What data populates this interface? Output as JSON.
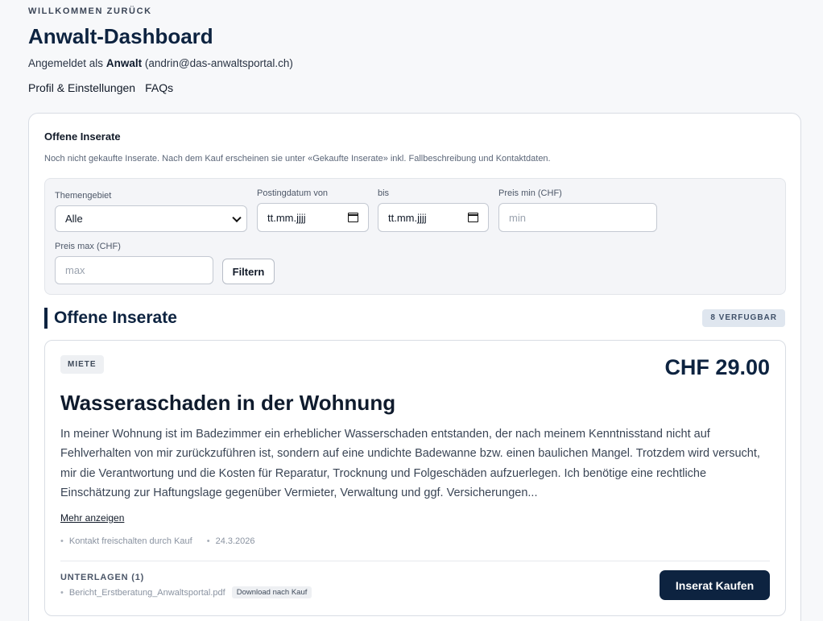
{
  "header": {
    "eyebrow": "WILLKOMMEN ZURÜCK",
    "title": "Anwalt-Dashboard",
    "signed_in_prefix": "Angemeldet als",
    "role": "Anwalt",
    "email": "(andrin@das-anwaltsportal.ch)",
    "nav": [
      "Profil & Einstellungen",
      "FAQs"
    ]
  },
  "panel": {
    "title": "Offene Inserate",
    "subtitle": "Noch nicht gekaufte Inserate. Nach dem Kauf erscheinen sie unter «Gekaufte Inserate» inkl. Fallbeschreibung und Kontaktdaten."
  },
  "filters": {
    "topic_label": "Themengebiet",
    "topic_value": "Alle",
    "date_from_label": "Postingdatum von",
    "date_from_value": "tt.mm.jjjj",
    "date_to_label": "bis",
    "date_to_value": "tt.mm.jjjj",
    "price_min_label": "Preis min (CHF)",
    "price_min_placeholder": "min",
    "price_max_label": "Preis max (CHF)",
    "price_max_placeholder": "max",
    "filter_button": "Filtern"
  },
  "listing_section": {
    "title": "Offene Inserate",
    "count_badge": "8 VERFUGBAR"
  },
  "listing": {
    "tag": "MIETE",
    "price": "CHF 29.00",
    "title": "Wasseraschaden in der Wohnung",
    "description": "In meiner Wohnung ist im Badezimmer ein erheblicher Wasserschaden entstanden, der nach meinem Kenntnisstand nicht auf Fehlverhalten von mir zurückzuführen ist, sondern auf eine undichte Badewanne bzw. einen baulichen Mangel. Trotzdem wird versucht, mir die Verantwortung und die Kosten für Reparatur, Trocknung und Folgeschäden aufzuerlegen. Ich benötige eine rechtliche Einschätzung zur Haftungslage gegenüber Vermieter, Verwaltung und ggf. Versicherungen...",
    "more_link": "Mehr anzeigen",
    "meta_contact": "Kontakt freischalten durch Kauf",
    "meta_date": "24.3.2026",
    "docs_label": "UNTERLAGEN (1)",
    "doc_file": "Bericht_Erstberatung_Anwaltsportal.pdf",
    "doc_lock": "Download nach Kauf",
    "buy_button": "Inserat Kaufen"
  },
  "icons": {
    "select": "chevron-down-icon",
    "date": "calendar-icon"
  },
  "colors": {
    "primary": "#0d2340",
    "background": "#f7f8fa"
  }
}
